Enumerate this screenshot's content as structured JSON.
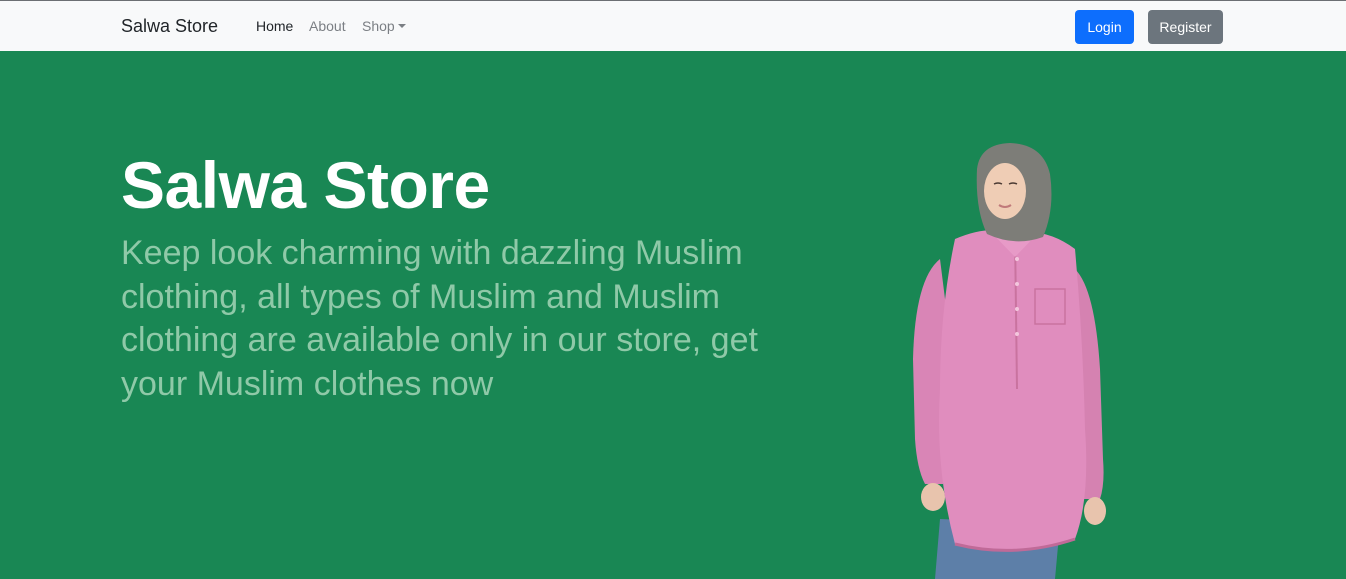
{
  "navbar": {
    "brand": "Salwa Store",
    "links": [
      {
        "label": "Home"
      },
      {
        "label": "About"
      },
      {
        "label": "Shop"
      }
    ],
    "login_label": "Login",
    "register_label": "Register"
  },
  "hero": {
    "title": "Salwa Store",
    "subtitle": "Keep look charming with dazzling Muslim clothing, all types of Muslim and Muslim clothing are available only in our store, get your Muslim clothes now"
  },
  "colors": {
    "hero_bg": "#198754",
    "login": "#0d6efd",
    "register": "#6c757d",
    "navbar_bg": "#f8f9fa"
  },
  "icons": [
    "dropdown-caret-icon"
  ]
}
